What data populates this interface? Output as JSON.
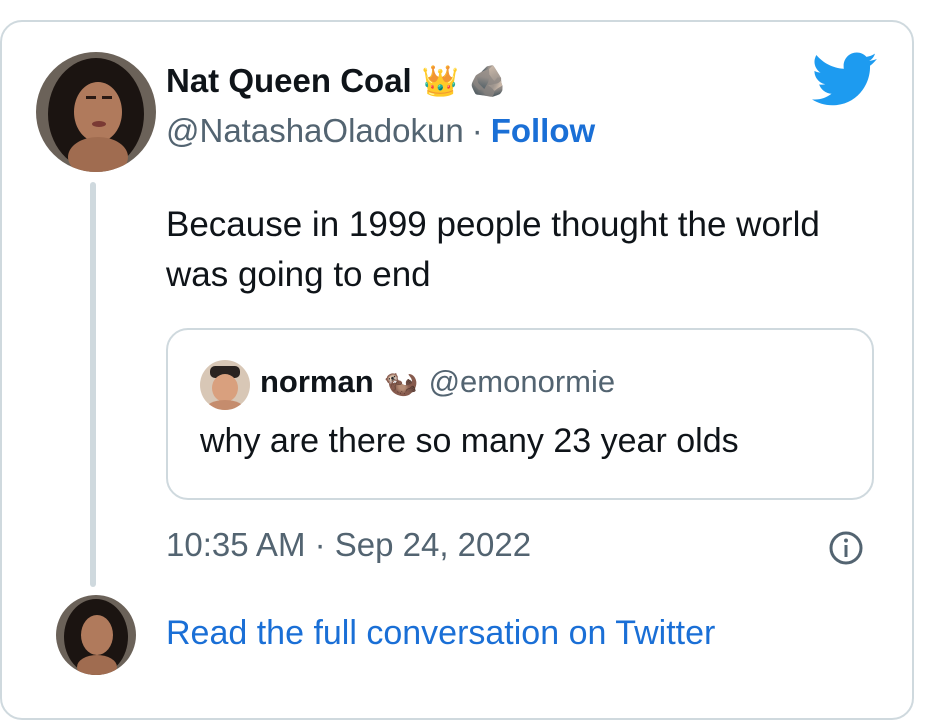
{
  "tweet": {
    "author_name": "Nat Queen Coal",
    "name_emojis": [
      "👑",
      "🪨"
    ],
    "handle": "@NatashaOladokun",
    "separator": "·",
    "follow_label": "Follow",
    "text": "Because in 1999 people thought the world was going to end",
    "timestamp": "10:35 AM · Sep 24, 2022"
  },
  "quote": {
    "author_name": "norman",
    "name_emoji": "🦦",
    "handle": "@emonormie",
    "text": "why are there so many 23 year olds"
  },
  "footer": {
    "read_more_label": "Read the full conversation on Twitter"
  },
  "colors": {
    "link": "#1a6fd6",
    "twitter_blue": "#1d9bf0",
    "border": "#cfd9de",
    "secondary_text": "#536471",
    "primary_text": "#0f1419"
  },
  "icons": {
    "brand": "twitter-bird-icon",
    "info": "info-icon"
  }
}
